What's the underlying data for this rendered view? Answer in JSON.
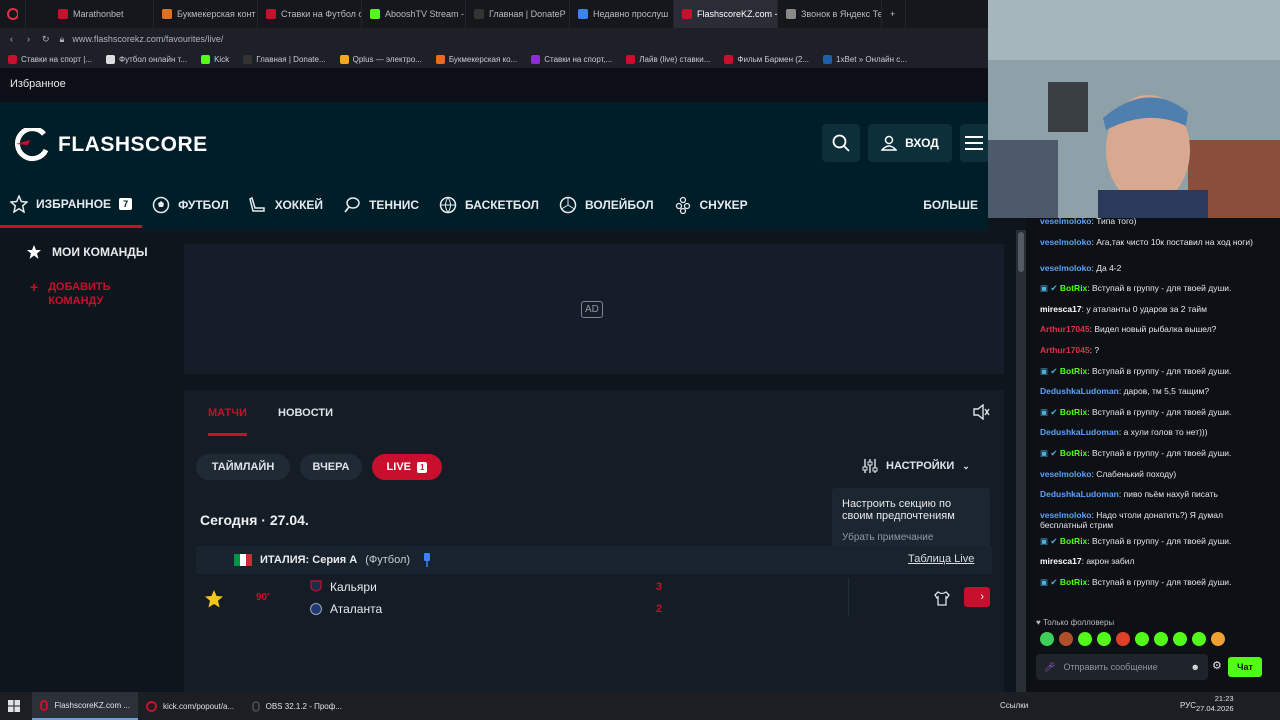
{
  "browser": {
    "tabs": [
      {
        "label": "Marathonbet",
        "color": "#c8102e"
      },
      {
        "label": "Букмекерская конт",
        "color": "#e07020"
      },
      {
        "label": "Ставки на Футбол о",
        "color": "#c8102e"
      },
      {
        "label": "AbooshTV Stream -",
        "color": "#53fc18"
      },
      {
        "label": "Главная | DonateP",
        "color": "#333333"
      },
      {
        "label": "Недавно прослуш",
        "color": "#3b82f6"
      },
      {
        "label": "FlashscoreKZ.com - Избр",
        "color": "#c8102e",
        "active": true
      },
      {
        "label": "Звонок в Яндекс Те",
        "color": "#888888"
      }
    ],
    "url": "www.flashscorekz.com/favourites/live/",
    "bookmarks": [
      {
        "label": "Ставки на спорт |...",
        "color": "#c8102e"
      },
      {
        "label": "Футбол онлайн т...",
        "color": "#dddddd"
      },
      {
        "label": "Kick",
        "color": "#53fc18"
      },
      {
        "label": "Главная | Donate...",
        "color": "#333333"
      },
      {
        "label": "Qplus — электро...",
        "color": "#f5a623"
      },
      {
        "label": "Букмекерская ко...",
        "color": "#e07020"
      },
      {
        "label": "Ставки на спорт,...",
        "color": "#8a2be2"
      },
      {
        "label": "Лайв (live) ставки...",
        "color": "#c8102e"
      },
      {
        "label": "Фильм Бармен (2...",
        "color": "#c8102e"
      },
      {
        "label": "1xBet » Онлайн с...",
        "color": "#1f5fa8"
      }
    ]
  },
  "favourites_label": "Избранное",
  "header": {
    "logo": "FLASHSCORE",
    "login_label": "ВХОД"
  },
  "sport_nav": [
    {
      "label": "ИЗБРАННОЕ",
      "icon": "star-icon",
      "badge": "7",
      "active": true
    },
    {
      "label": "ФУТБОЛ",
      "icon": "football-icon"
    },
    {
      "label": "ХОККЕЙ",
      "icon": "hockey-icon"
    },
    {
      "label": "ТЕННИС",
      "icon": "tennis-icon"
    },
    {
      "label": "БАСКЕТБОЛ",
      "icon": "basketball-icon"
    },
    {
      "label": "ВОЛЕЙБОЛ",
      "icon": "volleyball-icon"
    },
    {
      "label": "СНУКЕР",
      "icon": "snooker-icon"
    },
    {
      "label": "БОЛЬШЕ"
    }
  ],
  "left_panel": {
    "my_teams": "МОИ КОМАНДЫ",
    "add_team": "ДОБАВИТЬ КОМАНДУ"
  },
  "ad_label": "AD",
  "content": {
    "tab_matches": "МАТЧИ",
    "tab_news": "НОВОСТИ",
    "filter_timeline": "ТАЙМЛАЙН",
    "filter_yesterday": "ВЧЕРА",
    "filter_live": "LIVE",
    "live_count": "1",
    "settings_label": "НАСТРОЙКИ",
    "tooltip_text": "Настроить секцию по своим предпочтениям",
    "tooltip_dismiss": "Убрать примечание",
    "date_label": "Сегодня · 27.04.",
    "league_name": "ИТАЛИЯ: Серия А",
    "league_sport": "(Футбол)",
    "table_live": "Таблица Live",
    "match": {
      "minute": "90'",
      "home": "Кальяри",
      "away": "Аталанта",
      "home_score": "3",
      "away_score": "2"
    }
  },
  "chat": {
    "messages": [
      {
        "user": "veselmoloko",
        "color": "#5aa0ff",
        "text": ": Типа того)"
      },
      {
        "user": "veselmoloko",
        "color": "#5aa0ff",
        "text": ": Ага,так чисто 10к поставил на ход ноги)"
      },
      {
        "user": "veselmoloko",
        "color": "#5aa0ff",
        "text": ": Да 4-2"
      },
      {
        "user": "BotRix",
        "color": "#53fc18",
        "text": ": Вступай в группу - для твоей души.",
        "bot": true
      },
      {
        "user": "miresca17",
        "color": "#ffffff",
        "text": ": у аталанты 0 ударов за 2 тайм"
      },
      {
        "user": "Arthur17045",
        "color": "#e0304a",
        "text": ": Видел новый рыбалка вышел?"
      },
      {
        "user": "Arthur17045",
        "color": "#e0304a",
        "text": ": ?"
      },
      {
        "user": "BotRix",
        "color": "#53fc18",
        "text": ": Вступай в группу - для твоей души.",
        "bot": true
      },
      {
        "user": "DedushkaLudoman",
        "color": "#5aa0ff",
        "text": ": даров, тм 5,5 тащим?"
      },
      {
        "user": "BotRix",
        "color": "#53fc18",
        "text": ": Вступай в группу - для твоей души.",
        "bot": true
      },
      {
        "user": "DedushkaLudoman",
        "color": "#5aa0ff",
        "text": ": а хули голов то нет)))"
      },
      {
        "user": "BotRix",
        "color": "#53fc18",
        "text": ": Вступай в группу - для твоей души.",
        "bot": true
      },
      {
        "user": "veselmoloko",
        "color": "#5aa0ff",
        "text": ": Слабенький походу)"
      },
      {
        "user": "DedushkaLudoman",
        "color": "#5aa0ff",
        "text": ": пиво пьём нахуй писать"
      },
      {
        "user": "veselmoloko",
        "color": "#5aa0ff",
        "text": ": Надо чтоли донатить?) Я думал бесплатный стрим"
      },
      {
        "user": "BotRix",
        "color": "#53fc18",
        "text": ": Вступай в группу - для твоей души.",
        "bot": true
      },
      {
        "user": "miresca17",
        "color": "#ffffff",
        "text": ": акрон забил"
      },
      {
        "user": "BotRix",
        "color": "#53fc18",
        "text": ": Вступай в группу - для твоей души.",
        "bot": true
      }
    ],
    "followers_only": "Только фолловеры",
    "input_placeholder": "Отправить сообщение",
    "send_label": "Чат"
  },
  "taskbar": {
    "items": [
      {
        "label": "FlashscoreKZ.com ...",
        "color": "#c8102e",
        "active": true
      },
      {
        "label": "kick.com/popout/a...",
        "color": "#c8102e"
      },
      {
        "label": "OBS 32.1.2 - Проф...",
        "color": "#444444"
      }
    ],
    "links_label": "Ссылки",
    "lang": "РУС",
    "time": "21:23",
    "date": "27.04.2026"
  }
}
